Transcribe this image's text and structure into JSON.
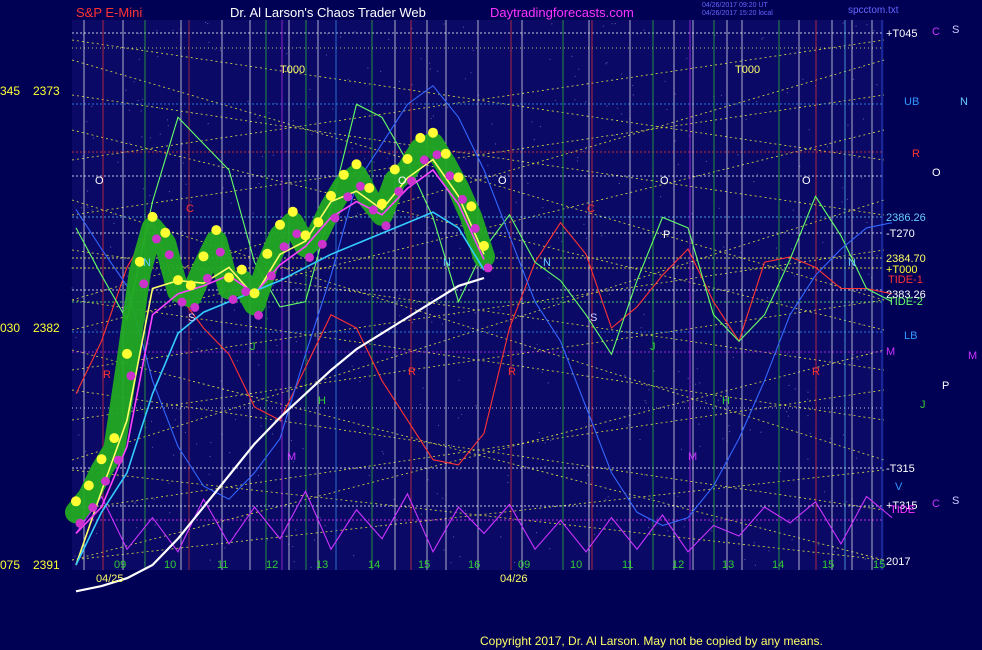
{
  "header": {
    "instrument": "S&P E-Mini",
    "author": "Dr. Al Larson's Chaos Trader Web",
    "website": "Daytradingforecasts.com",
    "timestamp1": "04/26/2017 09:20 UT",
    "timestamp2": "04/26/2017 15:20 local",
    "file": "spcctom.txt"
  },
  "footer": {
    "copyright": "Copyright 2017, Dr. Al Larson. May not be copied by any means."
  },
  "y_axis_labels": [
    {
      "left": "075",
      "price": "2391"
    },
    {
      "left": "030",
      "price": "2382"
    },
    {
      "left": "345",
      "price": "2373"
    }
  ],
  "right_labels": [
    {
      "text": "+T045",
      "color": "#ffffff"
    },
    {
      "text": "C",
      "color": "#cc33ff"
    },
    {
      "text": "S",
      "color": "#ccccff"
    },
    {
      "text": "UB",
      "color": "#3399ff"
    },
    {
      "text": "N",
      "color": "#66ccff"
    },
    {
      "text": "R",
      "color": "#ff3333"
    },
    {
      "text": "O",
      "color": "#ffffff"
    },
    {
      "text": "2386.26",
      "color": "#66ccff"
    },
    {
      "text": "-T270",
      "color": "#ffffff"
    },
    {
      "text": "2384.70",
      "color": "#ffff66"
    },
    {
      "text": "+T000",
      "color": "#ffff33"
    },
    {
      "text": "TIDE-1",
      "color": "#ff3333"
    },
    {
      "text": "2383.26",
      "color": "#ffffff"
    },
    {
      "text": "TIDE-2",
      "color": "#66ff66"
    },
    {
      "text": "LB",
      "color": "#3399ff"
    },
    {
      "text": "M",
      "color": "#cc33ff"
    },
    {
      "text": "M",
      "color": "#cc33ff"
    },
    {
      "text": "P",
      "color": "#ffffff"
    },
    {
      "text": "J",
      "color": "#33cc33"
    },
    {
      "text": "-T315",
      "color": "#ffffff"
    },
    {
      "text": "V",
      "color": "#3399ff"
    },
    {
      "text": "+T315",
      "color": "#ffffff"
    },
    {
      "text": "TIDE",
      "color": "#ff33ff"
    },
    {
      "text": "C",
      "color": "#cc33ff"
    },
    {
      "text": "S",
      "color": "#ccccff"
    },
    {
      "text": "2017",
      "color": "#ffffff"
    }
  ],
  "x_ticks": [
    {
      "label": "09",
      "color": "#33cc33"
    },
    {
      "label": "10",
      "color": "#33cc33"
    },
    {
      "label": "11",
      "color": "#33cc33"
    },
    {
      "label": "12",
      "color": "#33cc33"
    },
    {
      "label": "13",
      "color": "#33cc33"
    },
    {
      "label": "14",
      "color": "#33cc33"
    },
    {
      "label": "15",
      "color": "#33cc33"
    },
    {
      "label": "16",
      "color": "#33cc33"
    },
    {
      "label": "09",
      "color": "#33cc33"
    },
    {
      "label": "10",
      "color": "#33cc33"
    },
    {
      "label": "11",
      "color": "#33cc33"
    },
    {
      "label": "12",
      "color": "#33cc33"
    },
    {
      "label": "13",
      "color": "#33cc33"
    },
    {
      "label": "14",
      "color": "#33cc33"
    },
    {
      "label": "15",
      "color": "#33cc33"
    },
    {
      "label": "15",
      "color": "#33cc33"
    }
  ],
  "date_labels": [
    "04/25",
    "04/26"
  ],
  "letter_labels": [
    {
      "text": "T000",
      "color": "#ffff66"
    },
    {
      "text": "T000",
      "color": "#ffff66"
    },
    {
      "text": "O",
      "color": "#ffffff"
    },
    {
      "text": "O",
      "color": "#ffffff"
    },
    {
      "text": "O",
      "color": "#ffffff"
    },
    {
      "text": "O",
      "color": "#ffffff"
    },
    {
      "text": "O",
      "color": "#ffffff"
    },
    {
      "text": "C",
      "color": "#ff3333"
    },
    {
      "text": "C",
      "color": "#ff3333"
    },
    {
      "text": "N",
      "color": "#66ccff"
    },
    {
      "text": "N",
      "color": "#66ccff"
    },
    {
      "text": "N",
      "color": "#66ccff"
    },
    {
      "text": "N",
      "color": "#66ccff"
    },
    {
      "text": "P",
      "color": "#ffffff"
    },
    {
      "text": "S",
      "color": "#ccccff"
    },
    {
      "text": "S",
      "color": "#ccccff"
    },
    {
      "text": "J",
      "color": "#33cc33"
    },
    {
      "text": "J",
      "color": "#33cc33"
    },
    {
      "text": "R",
      "color": "#ff3333"
    },
    {
      "text": "R",
      "color": "#ff3333"
    },
    {
      "text": "R",
      "color": "#ff3333"
    },
    {
      "text": "R",
      "color": "#ff3333"
    },
    {
      "text": "M",
      "color": "#cc33ff"
    },
    {
      "text": "M",
      "color": "#cc33ff"
    },
    {
      "text": "H",
      "color": "#33cc33"
    },
    {
      "text": "H",
      "color": "#33cc33"
    }
  ],
  "colors": {
    "background": "#000055",
    "price_halo": "#22aa22",
    "price_high": "#ffff33",
    "price_low": "#cc33cc",
    "ma_fast": "#ffff66",
    "ma_mid": "#ff44ff",
    "ma_cyan": "#33ccff",
    "ma_white": "#ffffff",
    "grid_diag": "#dddd44"
  },
  "chart_data": {
    "type": "line",
    "ylim": [
      2373,
      2391
    ],
    "y_ticks": [
      2373,
      2382,
      2391
    ],
    "series": [
      {
        "name": "S&P E-Mini",
        "color": "#22aa22",
        "x": [
          0,
          0.25,
          0.5,
          0.75,
          1,
          1.25,
          1.5,
          1.75,
          2,
          2.25,
          2.5,
          2.75,
          3,
          3.25,
          3.5,
          3.75,
          4,
          4.25,
          4.5,
          4.75,
          5,
          5.25,
          5.5,
          5.75,
          6,
          6.25,
          6.5,
          6.75,
          7,
          7.25,
          7.5,
          7.75,
          8
        ],
        "y": [
          2375.0,
          2375.6,
          2376.6,
          2377.4,
          2380.6,
          2384.1,
          2385.8,
          2385.2,
          2383.4,
          2383.2,
          2384.3,
          2385.3,
          2383.5,
          2383.8,
          2382.9,
          2384.4,
          2385.5,
          2386.0,
          2385.1,
          2385.6,
          2386.6,
          2387.4,
          2387.8,
          2386.9,
          2386.3,
          2387.6,
          2388.0,
          2388.8,
          2389.0,
          2388.2,
          2387.3,
          2386.2,
          2384.7
        ]
      },
      {
        "name": "TIDE-1",
        "color": "#ff3333",
        "x": [
          0,
          0.5,
          1,
          1.5,
          2,
          2.5,
          3,
          3.5,
          4,
          4.5,
          5,
          5.5,
          6,
          6.5,
          7,
          7.5,
          8,
          8.5,
          9,
          9.5,
          10,
          10.5,
          11,
          11.5,
          12,
          12.5,
          13,
          13.5,
          14,
          14.5,
          15,
          15.5,
          16
        ],
        "y": [
          2379.5,
          2381.5,
          2384.3,
          2386.0,
          2383.3,
          2382.0,
          2381.0,
          2379.0,
          2378.5,
          2380.5,
          2382.5,
          2382.0,
          2380.0,
          2378.5,
          2377.0,
          2376.8,
          2378.0,
          2382.0,
          2384.5,
          2386.0,
          2384.8,
          2382.0,
          2382.8,
          2384.0,
          2385.0,
          2383.0,
          2381.5,
          2384.5,
          2384.7,
          2384.3,
          2383.5,
          2383.5,
          2383.3
        ]
      },
      {
        "name": "TIDE-2",
        "color": "#66ff66",
        "x": [
          0,
          0.5,
          1,
          1.5,
          2,
          2.5,
          3,
          3.5,
          4,
          4.5,
          5,
          5.5,
          6,
          6.5,
          7,
          7.5,
          8,
          8.5,
          9,
          9.5,
          10,
          10.5,
          11,
          11.5,
          12,
          12.5,
          13,
          13.5,
          14,
          14.5,
          15,
          15.5,
          16
        ],
        "y": [
          2385.8,
          2384.0,
          2382.3,
          2386.8,
          2390.0,
          2389.0,
          2388.0,
          2384.5,
          2382.8,
          2383.0,
          2386.6,
          2390.5,
          2390.0,
          2388.3,
          2386.2,
          2383.0,
          2385.0,
          2386.3,
          2384.5,
          2383.8,
          2382.5,
          2381.0,
          2383.8,
          2386.2,
          2385.8,
          2382.5,
          2381.5,
          2382.5,
          2384.6,
          2387.0,
          2385.5,
          2383.5,
          2383.0
        ]
      },
      {
        "name": "LB",
        "color": "#3366ff",
        "x": [
          0,
          0.5,
          1,
          1.5,
          2,
          2.5,
          3,
          3.5,
          4,
          4.5,
          5,
          5.5,
          6,
          6.5,
          7,
          7.5,
          8,
          8.5,
          9,
          9.5,
          10,
          10.5,
          11,
          11.5,
          12,
          12.5,
          13,
          13.5,
          14,
          14.5,
          15,
          15.5,
          16
        ],
        "y": [
          2386.5,
          2385.0,
          2383.6,
          2380.0,
          2377.5,
          2376.0,
          2375.5,
          2376.5,
          2377.8,
          2381.0,
          2384.0,
          2387.5,
          2389.0,
          2390.5,
          2391.2,
          2390.0,
          2388.0,
          2385.5,
          2383.0,
          2381.5,
          2379.0,
          2376.5,
          2375.0,
          2374.5,
          2374.8,
          2376.0,
          2377.8,
          2380.0,
          2382.5,
          2384.0,
          2385.0,
          2385.8,
          2386.0
        ]
      },
      {
        "name": "TIDE",
        "color": "#cc33ff",
        "x": [
          0,
          0.5,
          1,
          1.5,
          2,
          2.5,
          3,
          3.5,
          4,
          4.5,
          5,
          5.5,
          6,
          6.5,
          7,
          7.5,
          8,
          8.5,
          9,
          9.5,
          10,
          10.5,
          11,
          11.5,
          12,
          12.5,
          13,
          13.5,
          14,
          14.5,
          15,
          15.5,
          16
        ],
        "y": [
          2374.2,
          2375.6,
          2373.6,
          2374.8,
          2373.5,
          2375.5,
          2373.8,
          2375.2,
          2374.0,
          2375.8,
          2373.6,
          2375.1,
          2374.0,
          2375.7,
          2373.5,
          2375.2,
          2374.2,
          2375.3,
          2373.6,
          2374.7,
          2373.5,
          2374.8,
          2373.6,
          2374.9,
          2373.5,
          2374.5,
          2374.1,
          2375.2,
          2374.6,
          2375.4,
          2373.8,
          2375.6,
          2374.8
        ]
      }
    ],
    "moving_averages": [
      {
        "name": "fast",
        "color": "#ffff66",
        "x": [
          0,
          0.5,
          1,
          1.5,
          2,
          2.5,
          3,
          3.5,
          4,
          4.5,
          5,
          5.5,
          6,
          6.5,
          7,
          7.5,
          8
        ],
        "y": [
          2373.0,
          2375.8,
          2378.5,
          2383.5,
          2383.8,
          2383.7,
          2384.3,
          2383.2,
          2384.8,
          2385.3,
          2386.8,
          2387.2,
          2386.5,
          2387.7,
          2388.4,
          2387.0,
          2384.8
        ]
      },
      {
        "name": "mid",
        "color": "#ff44ff",
        "x": [
          0,
          0.5,
          1,
          1.5,
          2,
          2.5,
          3,
          3.5,
          4,
          4.5,
          5,
          5.5,
          6,
          6.5,
          7,
          7.5,
          8
        ],
        "y": [
          2374.2,
          2375.2,
          2377.5,
          2382.5,
          2383.3,
          2383.6,
          2384.0,
          2383.3,
          2384.4,
          2385.1,
          2386.2,
          2386.8,
          2386.3,
          2387.3,
          2388.0,
          2386.7,
          2384.6
        ]
      },
      {
        "name": "cyan",
        "color": "#33ccff",
        "x": [
          0,
          0.5,
          1,
          1.5,
          2,
          2.5,
          3,
          3.5,
          4,
          4.5,
          5,
          5.5,
          6,
          6.5,
          7,
          7.5,
          8
        ],
        "y": [
          2373.0,
          2375.0,
          2376.5,
          2379.5,
          2381.8,
          2382.6,
          2383.0,
          2383.4,
          2383.8,
          2384.3,
          2384.8,
          2385.2,
          2385.6,
          2386.0,
          2386.4,
          2385.8,
          2384.2
        ]
      },
      {
        "name": "slow",
        "color": "#ffffff",
        "x": [
          0,
          0.5,
          1,
          1.5,
          2,
          2.5,
          3,
          3.5,
          4,
          4.5,
          5,
          5.5,
          6,
          6.5,
          7,
          7.5,
          8
        ],
        "y": [
          2372.0,
          2372.2,
          2372.5,
          2373.0,
          2374.0,
          2375.2,
          2376.4,
          2377.6,
          2378.6,
          2379.5,
          2380.4,
          2381.2,
          2381.8,
          2382.4,
          2383.0,
          2383.6,
          2383.9
        ]
      }
    ]
  }
}
